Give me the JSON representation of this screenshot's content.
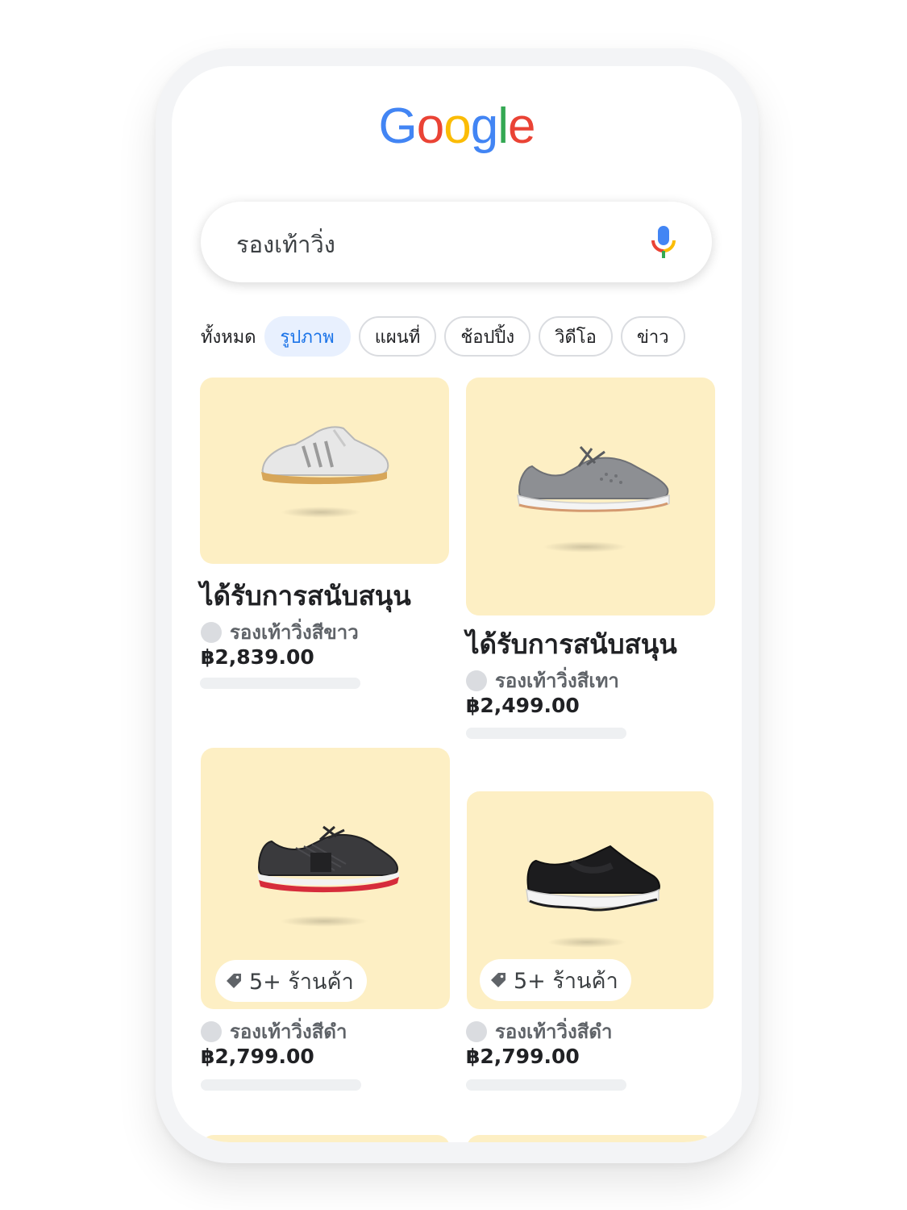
{
  "logo": {
    "letters": [
      "G",
      "o",
      "o",
      "g",
      "l",
      "e"
    ]
  },
  "search": {
    "query": "รองเท้าวิ่ง",
    "mic_icon": "mic-icon"
  },
  "filters": {
    "all_label": "ทั้งหมด",
    "chips": [
      {
        "label": "รูปภาพ",
        "active": true
      },
      {
        "label": "แผนที่",
        "active": false
      },
      {
        "label": "ช้อปปิ้ง",
        "active": false
      },
      {
        "label": "วิดีโอ",
        "active": false
      },
      {
        "label": "ข่าว",
        "active": false
      }
    ]
  },
  "products": [
    {
      "sponsored_label": "ได้รับการสนับสนุน",
      "store": "รองเท้าวิ่งสีขาว",
      "price": "฿2,839.00",
      "image": "white-sneaker"
    },
    {
      "sponsored_label": "ได้รับการสนับสนุน",
      "store": "รองเท้าวิ่งสีเทา",
      "price": "฿2,499.00",
      "image": "gray-sneaker"
    },
    {
      "badge": "5+ ร้านค้า",
      "badge_icon": "tag-icon",
      "store": "รองเท้าวิ่งสีดำ",
      "price": "฿2,799.00",
      "image": "black-red-sneaker"
    },
    {
      "badge": "5+ ร้านค้า",
      "badge_icon": "tag-icon",
      "store": "รองเท้าวิ่งสีดำ",
      "price": "฿2,799.00",
      "image": "black-slip-on-sneaker"
    }
  ],
  "colors": {
    "card_bg": "#fdefc4",
    "chip_active_bg": "#e8f0fe",
    "chip_active_text": "#1a73e8"
  }
}
